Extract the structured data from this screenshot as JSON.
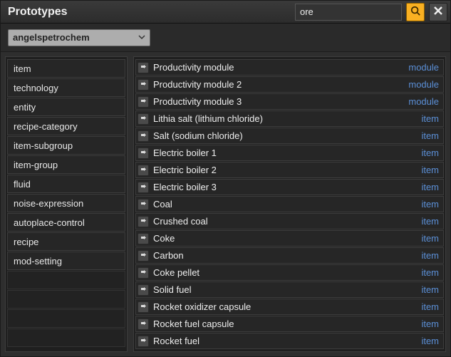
{
  "title": "Prototypes",
  "search": {
    "value": "ore",
    "placeholder": ""
  },
  "dropdown": {
    "selected": "angelspetrochem"
  },
  "categories": [
    "item",
    "technology",
    "entity",
    "recipe-category",
    "item-subgroup",
    "item-group",
    "fluid",
    "noise-expression",
    "autoplace-control",
    "recipe",
    "mod-setting"
  ],
  "results": [
    {
      "name": "Productivity module",
      "type": "module"
    },
    {
      "name": "Productivity module 2",
      "type": "module"
    },
    {
      "name": "Productivity module 3",
      "type": "module"
    },
    {
      "name": "Lithia salt (lithium chloride)",
      "type": "item"
    },
    {
      "name": "Salt (sodium chloride)",
      "type": "item"
    },
    {
      "name": "Electric boiler 1",
      "type": "item"
    },
    {
      "name": "Electric boiler 2",
      "type": "item"
    },
    {
      "name": "Electric boiler 3",
      "type": "item"
    },
    {
      "name": "Coal",
      "type": "item"
    },
    {
      "name": "Crushed coal",
      "type": "item"
    },
    {
      "name": "Coke",
      "type": "item"
    },
    {
      "name": "Carbon",
      "type": "item"
    },
    {
      "name": "Coke pellet",
      "type": "item"
    },
    {
      "name": "Solid fuel",
      "type": "item"
    },
    {
      "name": "Rocket oxidizer capsule",
      "type": "item"
    },
    {
      "name": "Rocket fuel capsule",
      "type": "item"
    },
    {
      "name": "Rocket fuel",
      "type": "item"
    }
  ],
  "empty_rows": 4
}
